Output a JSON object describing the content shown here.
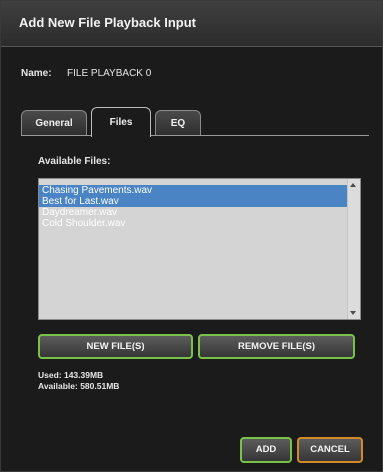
{
  "dialog": {
    "title": "Add New File Playback Input",
    "name_label": "Name:",
    "name_value": "FILE PLAYBACK 0"
  },
  "tabs": [
    {
      "label": "General",
      "active": false
    },
    {
      "label": "Files",
      "active": true
    },
    {
      "label": "EQ",
      "active": false
    }
  ],
  "files": {
    "label": "Available Files:",
    "items": [
      {
        "name": "Chasing Pavements.wav",
        "selected": true
      },
      {
        "name": "Best for Last.wav",
        "selected": true
      },
      {
        "name": "Daydreamer.wav",
        "selected": false
      },
      {
        "name": "Cold Shoulder.wav",
        "selected": false
      }
    ]
  },
  "buttons": {
    "new_files": "NEW FILE(S)",
    "remove_files": "REMOVE FILE(S)",
    "add": "ADD",
    "cancel": "CANCEL"
  },
  "storage": {
    "used": "Used: 143.39MB",
    "available": "Available: 580.51MB"
  },
  "colors": {
    "dialog_bg": "#1b1b1b",
    "selection": "#4a84c4",
    "green_border": "#79c24a",
    "orange_border": "#d18a2a"
  },
  "icons": [
    "scroll-up-arrow-icon",
    "scroll-down-arrow-icon"
  ]
}
